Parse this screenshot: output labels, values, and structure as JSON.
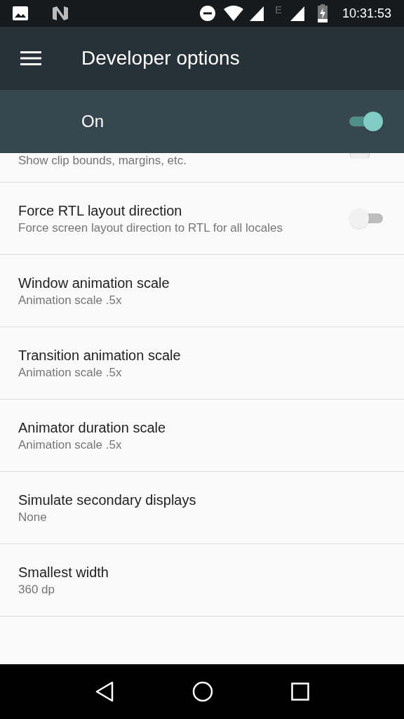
{
  "status_bar": {
    "network_type": "E",
    "time": "10:31:53"
  },
  "toolbar": {
    "title": "Developer options"
  },
  "master_switch": {
    "label": "On",
    "on": true
  },
  "partial_item": {
    "summary": "Show clip bounds, margins, etc.",
    "on": false
  },
  "items": [
    {
      "kind": "switch",
      "title": "Force RTL layout direction",
      "summary": "Force screen layout direction to RTL for all locales",
      "on": false
    },
    {
      "kind": "value",
      "title": "Window animation scale",
      "summary": "Animation scale .5x"
    },
    {
      "kind": "value",
      "title": "Transition animation scale",
      "summary": "Animation scale .5x"
    },
    {
      "kind": "value",
      "title": "Animator duration scale",
      "summary": "Animation scale .5x"
    },
    {
      "kind": "value",
      "title": "Simulate secondary displays",
      "summary": "None"
    },
    {
      "kind": "value",
      "title": "Smallest width",
      "summary": "360 dp"
    }
  ]
}
